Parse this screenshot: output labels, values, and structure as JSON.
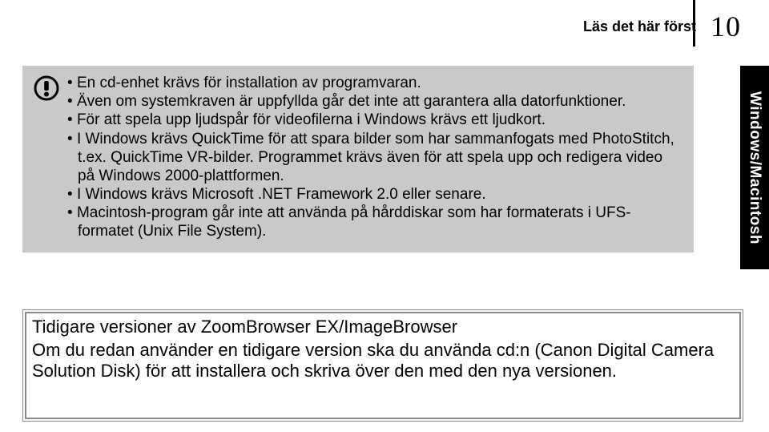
{
  "header": {
    "title": "Läs det här först",
    "page_number": "10"
  },
  "side_tab": "Windows/Macintosh",
  "warning": {
    "items": [
      "En cd-enhet krävs för installation av programvaran.",
      "Även om systemkraven är uppfyllda går det inte att garantera alla datorfunktioner.",
      "För att spela upp ljudspår för videofilerna i Windows krävs ett ljudkort.",
      "I Windows krävs QuickTime för att spara bilder som har sammanfogats med PhotoStitch, t.ex. QuickTime VR-bilder. Programmet krävs även för att spela upp och redigera video på Windows 2000-plattformen.",
      "I Windows krävs Microsoft .NET Framework 2.0 eller senare.",
      "Macintosh-program går inte att använda på hårddiskar som har formaterats i UFS-formatet (Unix File System)."
    ]
  },
  "previous": {
    "title": "Tidigare versioner av ZoomBrowser EX/ImageBrowser",
    "body": "Om du redan använder en tidigare version ska du använda cd:n (Canon Digital Camera Solution Disk) för att installera och skriva över den med den nya versionen."
  }
}
